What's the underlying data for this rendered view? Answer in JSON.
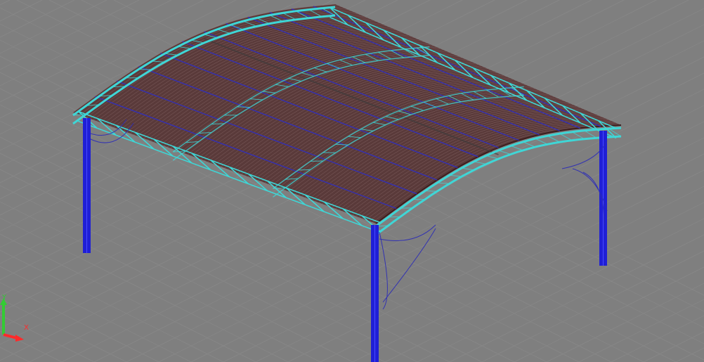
{
  "viewport": {
    "background": "#7f7f7f",
    "grid_color": "#8a8a8a",
    "ucs": {
      "x_label": "X",
      "y_label": "Y",
      "x_color": "#ff2a2a",
      "y_color": "#33cc33"
    }
  },
  "model": {
    "roof_sheet_color": "#5a3a3a",
    "roof_edge_color": "#3d1f1f",
    "truss_color": "#3fd6d6",
    "purlin_color": "#2f2fc2",
    "column_color": "#1f1fd6",
    "brace_color": "#2a2ab8"
  }
}
